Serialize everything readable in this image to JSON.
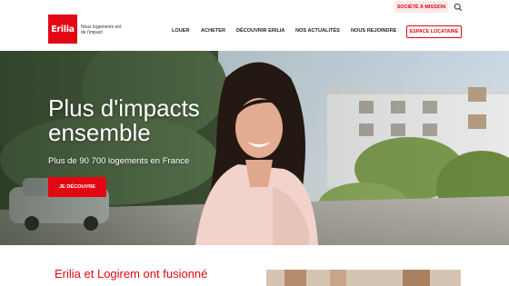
{
  "brand": {
    "logo_text": "Erilia",
    "tagline": "Nous logements ont de l'impact",
    "accent": "#e30613"
  },
  "header": {
    "mission_label": "SOCIÉTÉ À MISSION",
    "search_icon": "search-icon",
    "nav": [
      "LOUER",
      "ACHETER",
      "DÉCOUVRIR ERILIA",
      "NOS ACTUALITÉS",
      "NOUS REJOINDRE"
    ],
    "tenant_label": "ESPACE LOCATAIRE"
  },
  "hero": {
    "title": "Plus d'impacts ensemble",
    "subtitle": "Plus de 90 700 logements en France",
    "cta_label": "JE DÉCOUVRE"
  },
  "news": {
    "title": "Erilia et Logirem ont fusionné"
  }
}
